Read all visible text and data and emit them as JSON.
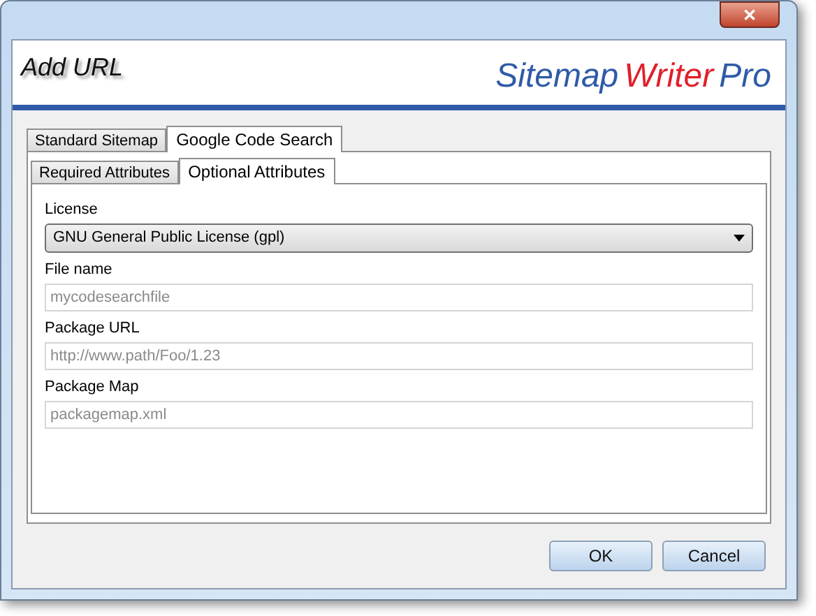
{
  "window": {
    "close_label": "✕"
  },
  "header": {
    "title": "Add URL",
    "logo": [
      {
        "text": "Sitemap",
        "color": "#2f5aa8"
      },
      {
        "text": "Writer",
        "color": "#e0202a"
      },
      {
        "text": "Pro",
        "color": "#2f5aa8"
      }
    ]
  },
  "tabs": [
    {
      "label": "Standard Sitemap",
      "selected": false
    },
    {
      "label": "Google Code Search",
      "selected": true
    }
  ],
  "subtabs": [
    {
      "label": "Required Attributes",
      "selected": false
    },
    {
      "label": "Optional Attributes",
      "selected": true
    }
  ],
  "fields": [
    {
      "kind": "dropdown",
      "label": "License",
      "value": "GNU General Public License (gpl)"
    },
    {
      "kind": "text",
      "label": "File name",
      "placeholder": "mycodesearchfile"
    },
    {
      "kind": "text",
      "label": "Package URL",
      "placeholder": "http://www.path/Foo/1.23"
    },
    {
      "kind": "text",
      "label": "Package Map",
      "placeholder": "packagemap.xml"
    }
  ],
  "buttons": [
    "OK",
    "Cancel"
  ]
}
